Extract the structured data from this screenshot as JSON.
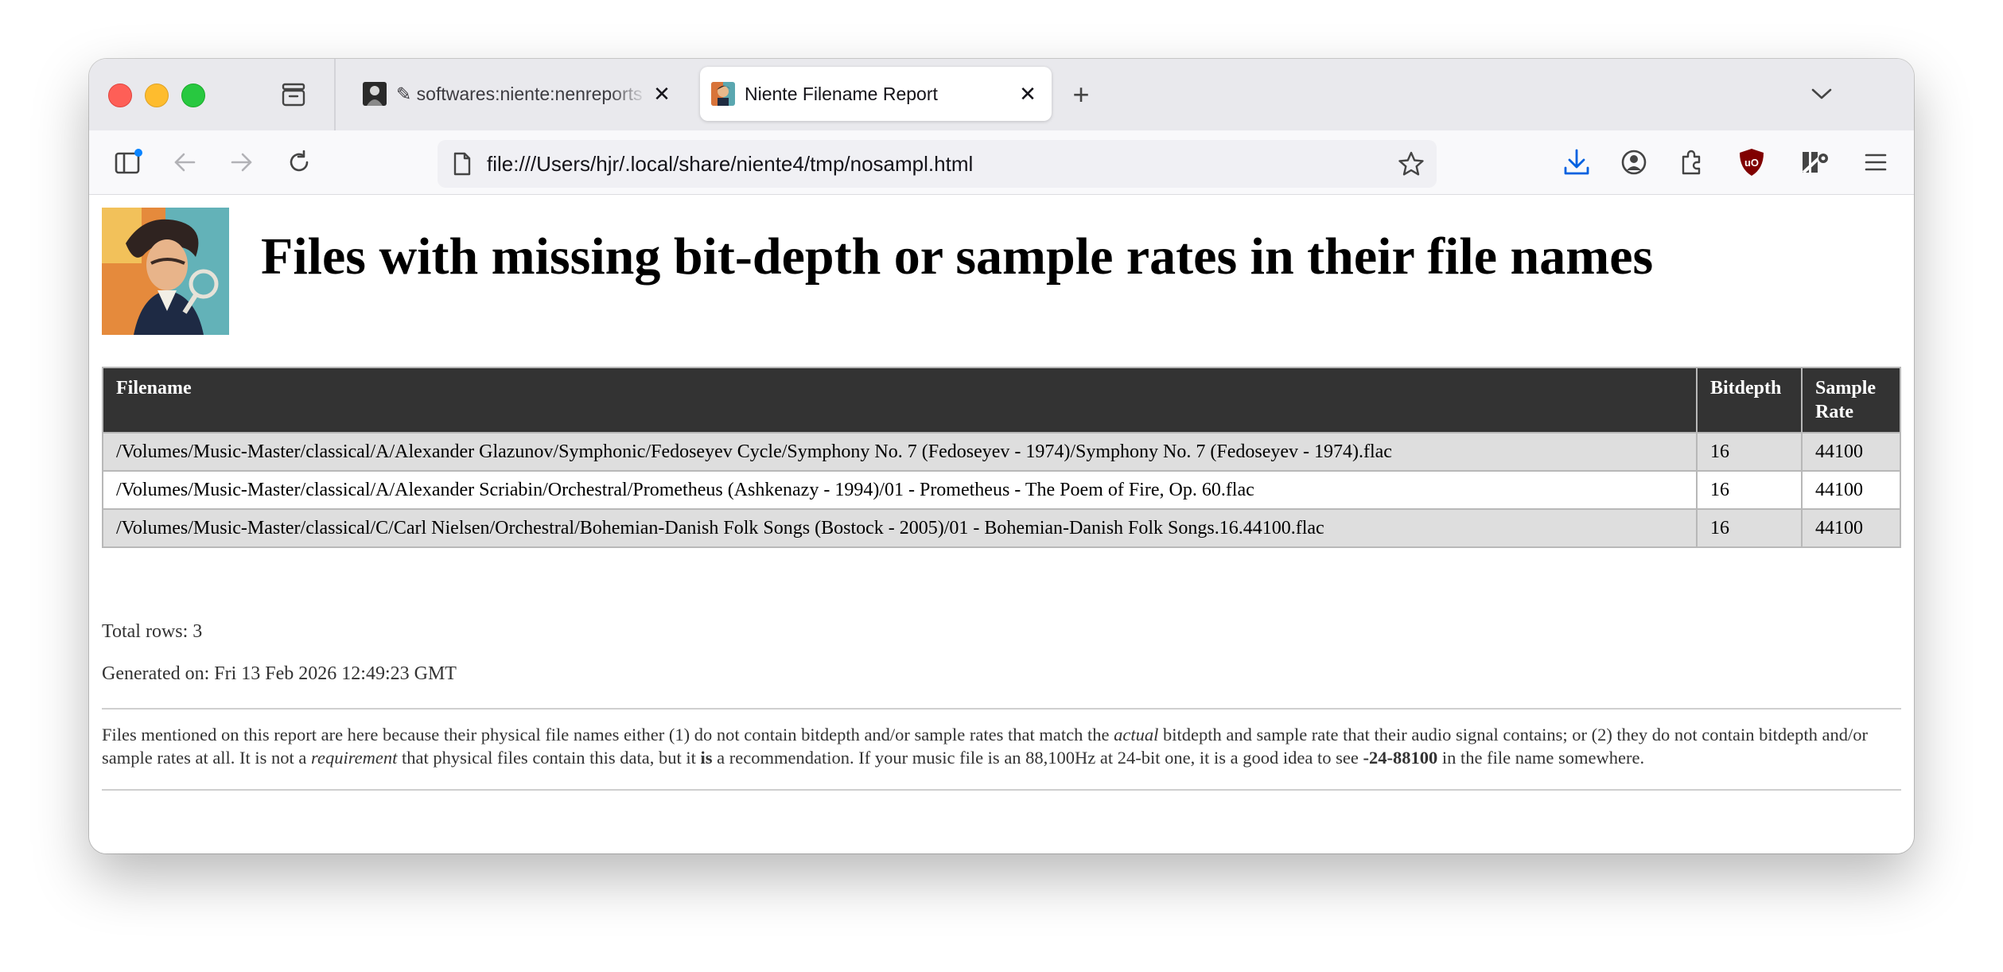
{
  "browser": {
    "tabs": [
      {
        "title": "✎ softwares:niente:nenreports [",
        "active": false
      },
      {
        "title": "Niente Filename Report",
        "active": true
      }
    ],
    "new_tab_label": "+",
    "close_label": "✕",
    "url": "file:///Users/hjr/.local/share/niente4/tmp/nosampl.html",
    "colors": {
      "tab_strip": "#e9e9ed",
      "download_icon": "#0061e0",
      "ublock_icon": "#800000"
    },
    "icons": [
      "tab-overview-icon",
      "sidebar-icon",
      "back-icon",
      "forward-icon",
      "reload-icon",
      "page-icon",
      "bookmark-star-icon",
      "downloads-icon",
      "account-icon",
      "extensions-icon",
      "ublock-icon",
      "extension-tool-icon",
      "menu-icon",
      "tab-list-chevron-icon"
    ]
  },
  "page": {
    "title": "Files with missing bit-depth or sample rates in their file names",
    "table": {
      "headers": [
        "Filename",
        "Bitdepth",
        "Sample Rate"
      ],
      "header_rate_line1": "Sample",
      "header_rate_line2": "Rate",
      "rows": [
        {
          "filename": "/Volumes/Music-Master/classical/A/Alexander Glazunov/Symphonic/Fedoseyev Cycle/Symphony No. 7 (Fedoseyev - 1974)/Symphony No. 7 (Fedoseyev - 1974).flac",
          "bitdepth": "16",
          "sample_rate": "44100"
        },
        {
          "filename": "/Volumes/Music-Master/classical/A/Alexander Scriabin/Orchestral/Prometheus (Ashkenazy - 1994)/01 - Prometheus - The Poem of Fire, Op. 60.flac",
          "bitdepth": "16",
          "sample_rate": "44100"
        },
        {
          "filename": "/Volumes/Music-Master/classical/C/Carl Nielsen/Orchestral/Bohemian-Danish Folk Songs (Bostock - 2005)/01 - Bohemian-Danish Folk Songs.16.44100.flac",
          "bitdepth": "16",
          "sample_rate": "44100"
        }
      ]
    },
    "total_rows": "Total rows: 3",
    "generated_on": "Generated on: Fri 13 Feb 2026 12:49:23 GMT",
    "note": {
      "p1": "Files mentioned on this report are here because their physical file names either (1) do not contain bitdepth and/or sample rates that match the ",
      "em1": "actual",
      "p2": " bitdepth and sample rate that their audio signal contains; or (2) they do not contain bitdepth and/or sample rates at all. It is not a ",
      "em2": "requirement",
      "p3": " that physical files contain this data, but it ",
      "strong1": "is",
      "p4": " a recommendation. If your music file is an 88,100Hz at 24-bit one, it is a good idea to see ",
      "strong2": "-24-88100",
      "p5": " in the file name somewhere."
    }
  }
}
